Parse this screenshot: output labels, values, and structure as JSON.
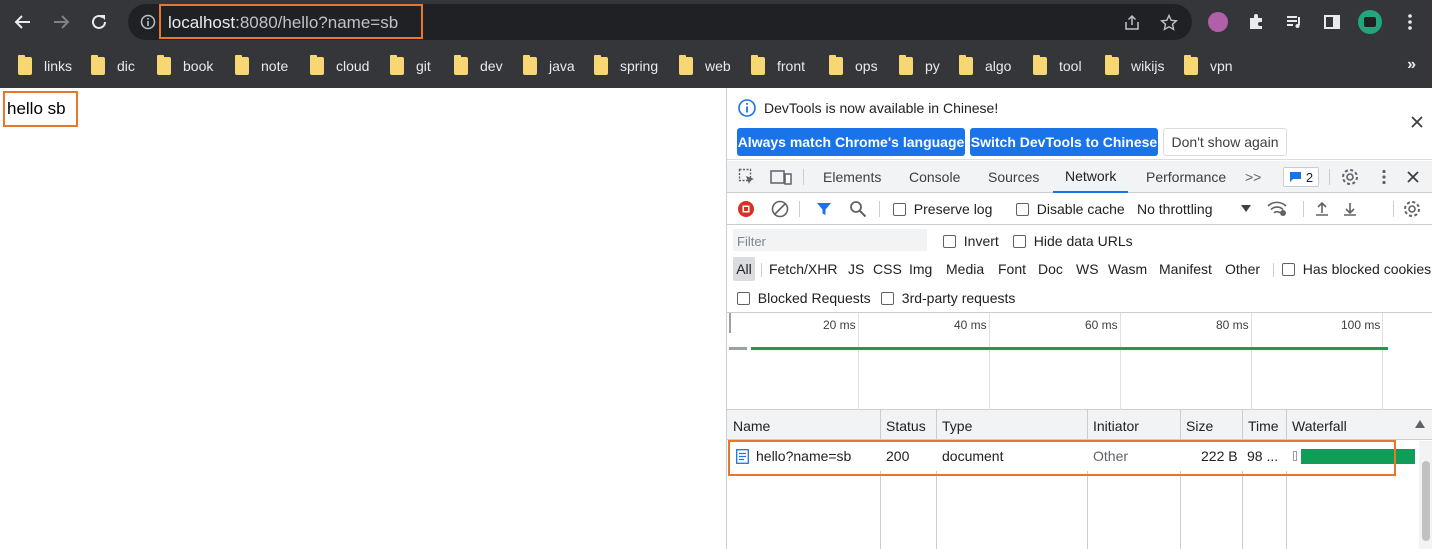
{
  "browser": {
    "url_host": "localhost",
    "url_rest": ":8080/hello?name=sb",
    "bookmarks": [
      "links",
      "dic",
      "book",
      "note",
      "cloud",
      "git",
      "dev",
      "java",
      "spring",
      "web",
      "front",
      "ops",
      "py",
      "algo",
      "tool",
      "wikijs",
      "vpn"
    ],
    "bookmarks_overflow": "»"
  },
  "page": {
    "body_text": "hello sb"
  },
  "devtools": {
    "banner": {
      "message": "DevTools is now available in Chinese!",
      "btn_match": "Always match Chrome's language",
      "btn_switch": "Switch DevTools to Chinese",
      "btn_dismiss": "Don't show again"
    },
    "tabs": [
      "Elements",
      "Console",
      "Sources",
      "Network",
      "Performance"
    ],
    "tabs_more": ">>",
    "issues_count": "2",
    "toolbar": {
      "preserve_log": "Preserve log",
      "disable_cache": "Disable cache",
      "throttling": "No throttling"
    },
    "filter": {
      "placeholder": "Filter",
      "invert": "Invert",
      "hide_data_urls": "Hide data URLs",
      "types": [
        "All",
        "Fetch/XHR",
        "JS",
        "CSS",
        "Img",
        "Media",
        "Font",
        "Doc",
        "WS",
        "Wasm",
        "Manifest",
        "Other"
      ],
      "has_blocked_cookies": "Has blocked cookies",
      "blocked_requests": "Blocked Requests",
      "third_party": "3rd-party requests"
    },
    "overview": {
      "ticks": [
        "20 ms",
        "40 ms",
        "60 ms",
        "80 ms",
        "100 ms"
      ]
    },
    "table": {
      "headers": [
        "Name",
        "Status",
        "Type",
        "Initiator",
        "Size",
        "Time",
        "Waterfall"
      ],
      "rows": [
        {
          "name": "hello?name=sb",
          "status": "200",
          "type": "document",
          "initiator": "Other",
          "size": "222 B",
          "time": "98 ..."
        }
      ]
    },
    "colors": {
      "accent": "#1a73e8",
      "highlight": "#e8772e",
      "waterfall": "#0f9d58"
    }
  }
}
